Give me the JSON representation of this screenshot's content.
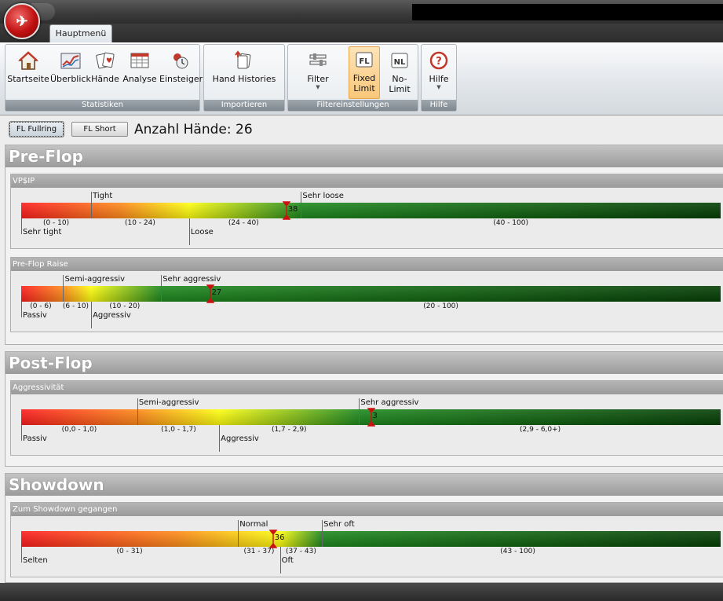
{
  "tabs": {
    "main": "Hauptmenü"
  },
  "ribbon": {
    "groups": [
      {
        "label": "Statistiken",
        "buttons": [
          {
            "label": "Startseite",
            "icon": "home-icon"
          },
          {
            "label": "Überblick",
            "icon": "chart-icon"
          },
          {
            "label": "Hände",
            "icon": "cards-icon"
          },
          {
            "label": "Analyse",
            "icon": "table-icon"
          },
          {
            "label": "Einsteiger",
            "icon": "beginner-icon"
          }
        ]
      },
      {
        "label": "Importieren",
        "buttons": [
          {
            "label": "Hand Histories",
            "icon": "import-icon"
          }
        ]
      },
      {
        "label": "Filtereinstellungen",
        "buttons": [
          {
            "label": "Filter",
            "icon": "filter-icon"
          },
          {
            "label": "Fixed",
            "label2": "Limit",
            "icon": "fixed-limit-icon",
            "badge": "FL"
          },
          {
            "label": "No-Limit",
            "icon": "no-limit-icon",
            "badge": "NL"
          }
        ]
      },
      {
        "label": "Hilfe",
        "buttons": [
          {
            "label": "Hilfe",
            "icon": "help-icon"
          }
        ]
      }
    ]
  },
  "toolbar": {
    "fullring": "FL Fullring",
    "short": "FL Short",
    "hands_label": "Anzahl Hände: 26"
  },
  "sections": [
    {
      "title": "Pre-Flop",
      "stats": [
        {
          "title": "VP$IP",
          "value": "38",
          "marker_pos": 0.379,
          "top_labels": [
            {
              "text": "Tight",
              "at": 0.1
            },
            {
              "text": "Sehr loose",
              "at": 0.4
            }
          ],
          "bottom_labels": [
            {
              "text": "Sehr tight",
              "at": 0.0
            },
            {
              "text": "Loose",
              "at": 0.24
            }
          ],
          "ranges": [
            {
              "text": "(0 - 10)",
              "at": 0.05
            },
            {
              "text": "(10 - 24)",
              "at": 0.17
            },
            {
              "text": "(24 - 40)",
              "at": 0.318
            },
            {
              "text": "(40 - 100)",
              "at": 0.7
            }
          ]
        },
        {
          "title": "Pre-Flop Raise",
          "value": "27",
          "marker_pos": 0.27,
          "top_labels": [
            {
              "text": "Semi-aggressiv",
              "at": 0.06
            },
            {
              "text": "Sehr aggressiv",
              "at": 0.2
            }
          ],
          "bottom_labels": [
            {
              "text": "Passiv",
              "at": 0.0
            },
            {
              "text": "Aggressiv",
              "at": 0.1
            }
          ],
          "ranges": [
            {
              "text": "(0 - 6)",
              "at": 0.028
            },
            {
              "text": "(6 - 10)",
              "at": 0.078
            },
            {
              "text": "(10 - 20)",
              "at": 0.148
            },
            {
              "text": "(20 - 100)",
              "at": 0.6
            }
          ]
        }
      ]
    },
    {
      "title": "Post-Flop",
      "stats": [
        {
          "title": "Aggressivität",
          "value": "3",
          "marker_pos": 0.5,
          "top_labels": [
            {
              "text": "Semi-aggressiv",
              "at": 0.166
            },
            {
              "text": "Sehr aggressiv",
              "at": 0.483
            }
          ],
          "bottom_labels": [
            {
              "text": "Passiv",
              "at": 0.0
            },
            {
              "text": "Aggressiv",
              "at": 0.283
            }
          ],
          "ranges": [
            {
              "text": "(0,0 - 1,0)",
              "at": 0.083
            },
            {
              "text": "(1,0 - 1,7)",
              "at": 0.225
            },
            {
              "text": "(1,7 - 2,9)",
              "at": 0.383
            },
            {
              "text": "(2,9 - 6,0+)",
              "at": 0.742
            }
          ]
        }
      ]
    },
    {
      "title": "Showdown",
      "stats": [
        {
          "title": "Zum Showdown gegangen",
          "value": "36",
          "marker_pos": 0.36,
          "top_labels": [
            {
              "text": "Normal",
              "at": 0.31
            },
            {
              "text": "Sehr oft",
              "at": 0.43
            }
          ],
          "bottom_labels": [
            {
              "text": "Selten",
              "at": 0.0
            },
            {
              "text": "Oft",
              "at": 0.37
            }
          ],
          "ranges": [
            {
              "text": "(0 - 31)",
              "at": 0.155
            },
            {
              "text": "(31 - 37)",
              "at": 0.34
            },
            {
              "text": "(37 - 43)",
              "at": 0.4
            },
            {
              "text": "(43 - 100)",
              "at": 0.71
            }
          ]
        }
      ]
    }
  ],
  "colors": {
    "red": "#ff1e1e",
    "yellow": "#ffff10",
    "green": "#1f8a1f",
    "dark_green": "#063f06",
    "marker": "#cc1111"
  }
}
